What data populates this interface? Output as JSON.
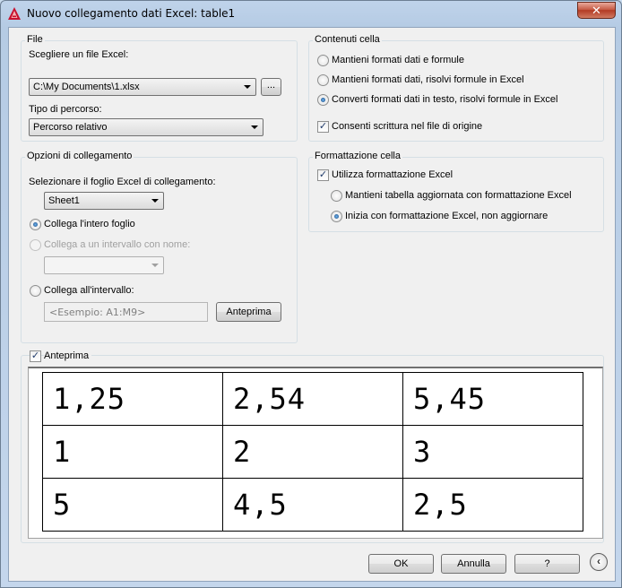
{
  "window": {
    "title": "Nuovo collegamento dati Excel: table1",
    "close": "✕"
  },
  "file": {
    "group_title": "File",
    "choose_label": "Scegliere un file Excel:",
    "file_value": "C:\\My Documents\\1.xlsx",
    "browse_label": "...",
    "path_type_label": "Tipo di percorso:",
    "path_type_value": "Percorso relativo"
  },
  "link_options": {
    "group_title": "Opzioni di collegamento",
    "sheet_label": "Selezionare il foglio Excel di collegamento:",
    "sheet_value": "Sheet1",
    "radio_entire": "Collega l'intero foglio",
    "radio_named": "Collega a un intervallo con nome:",
    "named_value": "",
    "radio_range": "Collega all'intervallo:",
    "range_placeholder": "<Esempio: A1:M9>",
    "preview_button": "Anteprima",
    "selected": "entire"
  },
  "cell_contents": {
    "group_title": "Contenuti cella",
    "opt1": "Mantieni formati dati e formule",
    "opt2": "Mantieni formati dati, risolvi formule in Excel",
    "opt3": "Converti formati dati in testo, risolvi formule in Excel",
    "selected": "opt3",
    "allow_write": "Consenti scrittura nel file di origine",
    "allow_write_checked": true
  },
  "cell_format": {
    "group_title": "Formattazione cella",
    "use_excel": "Utilizza formattazione Excel",
    "use_excel_checked": true,
    "opt_keep": "Mantieni tabella aggiornata con formattazione Excel",
    "opt_start": "Inizia con formattazione Excel, non aggiornare",
    "selected": "opt_start"
  },
  "preview": {
    "label": "Anteprima",
    "checked": true,
    "rows": [
      [
        "1,25",
        "2,54",
        "5,45"
      ],
      [
        "1",
        "2",
        "3"
      ],
      [
        "5",
        "4,5",
        "2,5"
      ]
    ]
  },
  "buttons": {
    "ok": "OK",
    "cancel": "Annulla",
    "help": "?",
    "back": "‹"
  }
}
